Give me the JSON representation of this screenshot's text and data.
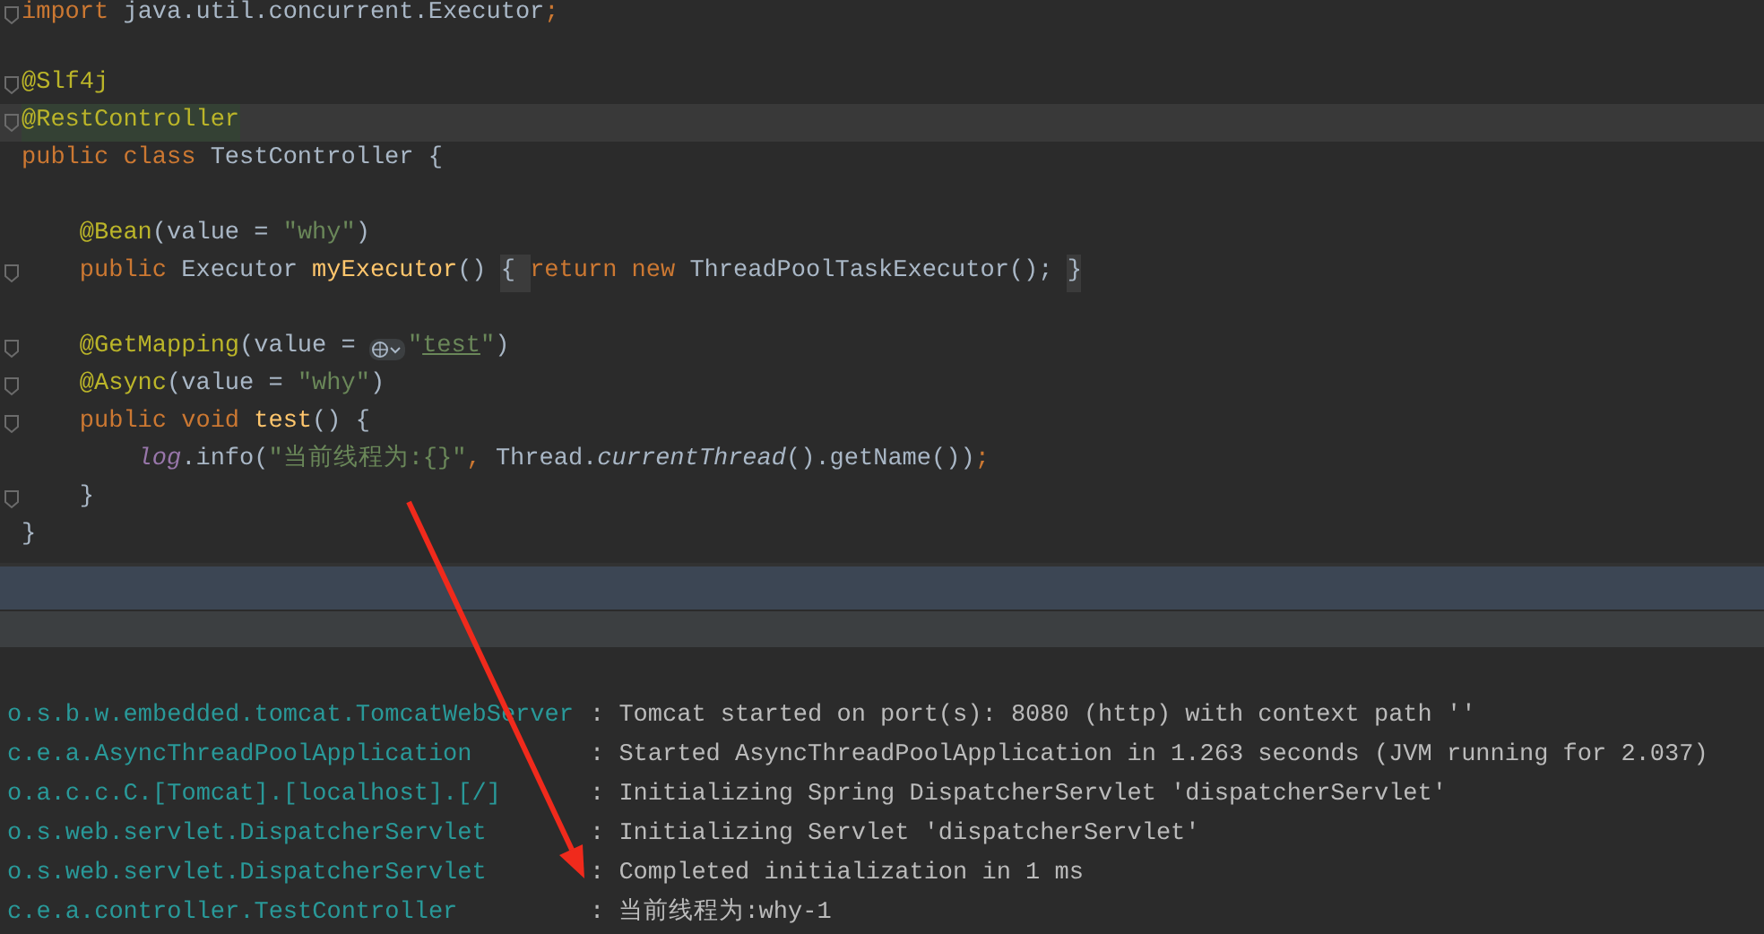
{
  "editor": {
    "lines": [
      {
        "fold": true,
        "current": false,
        "tokens": [
          {
            "kind": "kw",
            "text": "import "
          },
          {
            "kind": "plain",
            "text": "java.util.concurrent.Executor"
          },
          {
            "kind": "kw",
            "text": ";"
          }
        ]
      },
      {
        "fold": false,
        "current": false
      },
      {
        "fold": true,
        "current": false,
        "tokens": [
          {
            "kind": "ann",
            "text": "@Slf4j"
          }
        ]
      },
      {
        "fold": true,
        "current": true,
        "tokens": [
          {
            "kind": "ann-hl",
            "text": "@RestController"
          }
        ]
      },
      {
        "fold": false,
        "current": false,
        "tokens": [
          {
            "kind": "kw",
            "text": "public class "
          },
          {
            "kind": "plain",
            "text": "TestController {"
          }
        ]
      },
      {
        "fold": false,
        "current": false
      },
      {
        "fold": false,
        "current": false,
        "tokens": [
          {
            "kind": "ann",
            "text": "    @Bean"
          },
          {
            "kind": "plain",
            "text": "(value = "
          },
          {
            "kind": "str",
            "text": "\"why\""
          },
          {
            "kind": "plain",
            "text": ")"
          }
        ]
      },
      {
        "fold": true,
        "current": false,
        "tokens": [
          {
            "kind": "kw",
            "text": "    public "
          },
          {
            "kind": "plain",
            "text": "Executor "
          },
          {
            "kind": "method",
            "text": "myExecutor"
          },
          {
            "kind": "plain",
            "text": "() "
          },
          {
            "kind": "folded",
            "text": "{ "
          },
          {
            "kind": "kw",
            "text": "return new "
          },
          {
            "kind": "plain",
            "text": "ThreadPoolTaskExecutor(); "
          },
          {
            "kind": "folded",
            "text": "}"
          }
        ]
      },
      {
        "fold": false,
        "current": false
      },
      {
        "fold": true,
        "current": false,
        "tokens": [
          {
            "kind": "ann",
            "text": "    @GetMapping"
          },
          {
            "kind": "plain",
            "text": "(value = "
          },
          {
            "kind": "globe"
          },
          {
            "kind": "str",
            "text": "\""
          },
          {
            "kind": "url",
            "text": "test"
          },
          {
            "kind": "str",
            "text": "\""
          },
          {
            "kind": "plain",
            "text": ")"
          }
        ]
      },
      {
        "fold": true,
        "current": false,
        "tokens": [
          {
            "kind": "ann",
            "text": "    @Async"
          },
          {
            "kind": "plain",
            "text": "(value = "
          },
          {
            "kind": "str",
            "text": "\"why\""
          },
          {
            "kind": "plain",
            "text": ")"
          }
        ]
      },
      {
        "fold": true,
        "current": false,
        "tokens": [
          {
            "kind": "kw",
            "text": "    public void "
          },
          {
            "kind": "method",
            "text": "test"
          },
          {
            "kind": "plain",
            "text": "() {"
          }
        ]
      },
      {
        "fold": false,
        "current": false,
        "tokens": [
          {
            "kind": "field",
            "text": "        log"
          },
          {
            "kind": "plain",
            "text": ".info("
          },
          {
            "kind": "str",
            "text": "\"当前线程为:{}\""
          },
          {
            "kind": "kw",
            "text": ", "
          },
          {
            "kind": "plain",
            "text": "Thread."
          },
          {
            "kind": "italic",
            "text": "currentThread"
          },
          {
            "kind": "plain",
            "text": "().getName())"
          },
          {
            "kind": "kw",
            "text": ";"
          }
        ]
      },
      {
        "fold": true,
        "current": false,
        "tokens": [
          {
            "kind": "plain",
            "text": "    }"
          }
        ]
      },
      {
        "fold": false,
        "current": false,
        "tokens": [
          {
            "kind": "plain",
            "text": "}"
          }
        ]
      }
    ]
  },
  "console": {
    "rows": [
      {
        "logger": "o.s.b.w.embedded.tomcat.TomcatWebServer",
        "message": ": Tomcat started on port(s): 8080 (http) with context path ''"
      },
      {
        "logger": "c.e.a.AsyncThreadPoolApplication",
        "message": ": Started AsyncThreadPoolApplication in 1.263 seconds (JVM running for 2.037)"
      },
      {
        "logger": "o.a.c.c.C.[Tomcat].[localhost].[/]",
        "message": ": Initializing Spring DispatcherServlet 'dispatcherServlet'"
      },
      {
        "logger": "o.s.web.servlet.DispatcherServlet",
        "message": ": Initializing Servlet 'dispatcherServlet'"
      },
      {
        "logger": "o.s.web.servlet.DispatcherServlet",
        "message": ": Completed initialization in 1 ms"
      },
      {
        "logger": "c.e.a.controller.TestController",
        "message": ": 当前线程为:why-1"
      }
    ]
  }
}
